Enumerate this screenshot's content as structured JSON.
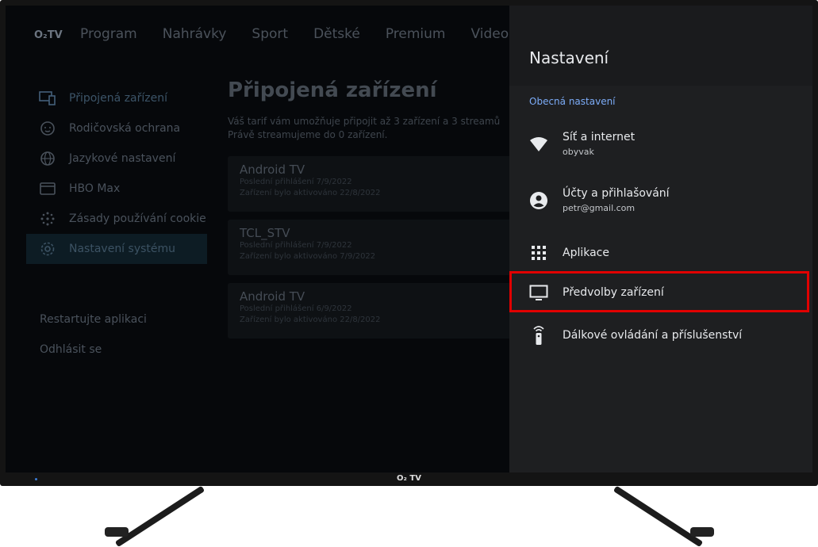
{
  "brand": {
    "logo_text": "O₂TV",
    "bezel_logo": "O₂ TV"
  },
  "nav": {
    "items": [
      {
        "label": "Program"
      },
      {
        "label": "Nahrávky"
      },
      {
        "label": "Sport"
      },
      {
        "label": "Dětské"
      },
      {
        "label": "Premium"
      },
      {
        "label": "Video"
      }
    ]
  },
  "sidebar": {
    "items": [
      {
        "label": "Připojená zařízení",
        "icon": "devices-icon"
      },
      {
        "label": "Rodičovská ochrana",
        "icon": "child-face-icon"
      },
      {
        "label": "Jazykové nastavení",
        "icon": "globe-icon"
      },
      {
        "label": "HBO Max",
        "icon": "card-icon"
      },
      {
        "label": "Zásady používání cookie",
        "icon": "cookie-icon"
      },
      {
        "label": "Nastavení systému",
        "icon": "gear-icon"
      }
    ],
    "restart_label": "Restartujte aplikaci",
    "logout_label": "Odhlásit se"
  },
  "main": {
    "title": "Připojená zařízení",
    "description_line1": "Váš tarif vám umožňuje připojit až 3 zařízení a 3 streamů",
    "description_line2": "Právě streamujeme do 0 zařízení.",
    "devices": [
      {
        "name": "Android TV",
        "last_login": "Poslední přihlášení 7/9/2022",
        "activated": "Zařízení bylo aktivováno 22/8/2022"
      },
      {
        "name": "TCL_STV",
        "last_login": "Poslední přihlášení 7/9/2022",
        "activated": "Zařízení bylo aktivováno 7/9/2022"
      },
      {
        "name": "Android TV",
        "last_login": "Poslední přihlášení 6/9/2022",
        "activated": "Zařízení bylo aktivováno 22/8/2022"
      }
    ]
  },
  "settings_panel": {
    "title": "Nastavení",
    "section_label": "Obecná nastavení",
    "items": [
      {
        "label": "Síť a internet",
        "sub": "obyvak",
        "icon": "wifi-icon"
      },
      {
        "label": "Účty a přihlašování",
        "sub": "petr@gmail.com",
        "icon": "account-icon"
      },
      {
        "label": "Aplikace",
        "sub": "",
        "icon": "apps-grid-icon"
      },
      {
        "label": "Předvolby zařízení",
        "sub": "",
        "icon": "tv-icon",
        "highlighted": true
      },
      {
        "label": "Dálkové ovládání a příslušenství",
        "sub": "",
        "icon": "remote-icon"
      }
    ]
  },
  "colors": {
    "panel_bg": "#1e1f21",
    "accent_blue": "#7cacf8",
    "highlight_red": "#e10000"
  }
}
